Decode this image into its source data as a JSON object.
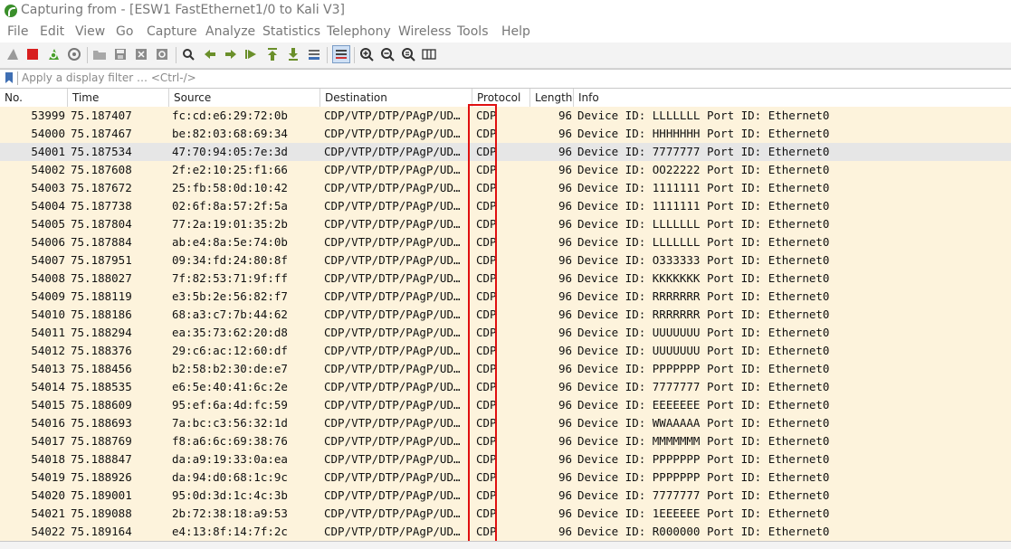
{
  "window": {
    "title": "Capturing from - [ESW1 FastEthernet1/0 to Kali V3]"
  },
  "menu": [
    "File",
    "Edit",
    "View",
    "Go",
    "Capture",
    "Analyze",
    "Statistics",
    "Telephony",
    "Wireless",
    "Tools",
    "Help"
  ],
  "toolbar": {
    "icons": [
      "shark-fin-start-icon",
      "stop-icon",
      "restart-icon",
      "capture-options-icon",
      "open-file-icon",
      "save-file-icon",
      "close-file-icon",
      "reload-file-icon",
      "find-packet-icon",
      "go-back-icon",
      "go-forward-icon",
      "go-to-packet-icon",
      "first-packet-icon",
      "last-packet-icon",
      "autoscroll-icon",
      "colorize-icon",
      "zoom-in-icon",
      "zoom-out-icon",
      "normal-size-icon",
      "resize-columns-icon"
    ]
  },
  "filter": {
    "placeholder": "Apply a display filter … <Ctrl-/>"
  },
  "columns": {
    "no": "No.",
    "time": "Time",
    "source": "Source",
    "destination": "Destination",
    "protocol": "Protocol",
    "length": "Length",
    "info": "Info"
  },
  "colors": {
    "row_bg": "#fdf3dc",
    "selected_bg": "#e6e6e6",
    "highlight": "#e01010"
  },
  "packets": [
    {
      "no": "53999",
      "time": "75.187407",
      "source": "fc:cd:e6:29:72:0b",
      "destination": "CDP/VTP/DTP/PAgP/UD…",
      "protocol": "CDP",
      "length": "96",
      "info": "Device ID: LLLLLLL  Port ID: Ethernet0"
    },
    {
      "no": "54000",
      "time": "75.187467",
      "source": "be:82:03:68:69:34",
      "destination": "CDP/VTP/DTP/PAgP/UD…",
      "protocol": "CDP",
      "length": "96",
      "info": "Device ID: HHHHHHH  Port ID: Ethernet0"
    },
    {
      "no": "54001",
      "time": "75.187534",
      "source": "47:70:94:05:7e:3d",
      "destination": "CDP/VTP/DTP/PAgP/UD…",
      "protocol": "CDP",
      "length": "96",
      "info": "Device ID: 7777777  Port ID: Ethernet0",
      "selected": true
    },
    {
      "no": "54002",
      "time": "75.187608",
      "source": "2f:e2:10:25:f1:66",
      "destination": "CDP/VTP/DTP/PAgP/UD…",
      "protocol": "CDP",
      "length": "96",
      "info": "Device ID: OO22222  Port ID: Ethernet0"
    },
    {
      "no": "54003",
      "time": "75.187672",
      "source": "25:fb:58:0d:10:42",
      "destination": "CDP/VTP/DTP/PAgP/UD…",
      "protocol": "CDP",
      "length": "96",
      "info": "Device ID: 1111111  Port ID: Ethernet0"
    },
    {
      "no": "54004",
      "time": "75.187738",
      "source": "02:6f:8a:57:2f:5a",
      "destination": "CDP/VTP/DTP/PAgP/UD…",
      "protocol": "CDP",
      "length": "96",
      "info": "Device ID: 1111111  Port ID: Ethernet0"
    },
    {
      "no": "54005",
      "time": "75.187804",
      "source": "77:2a:19:01:35:2b",
      "destination": "CDP/VTP/DTP/PAgP/UD…",
      "protocol": "CDP",
      "length": "96",
      "info": "Device ID: LLLLLLL  Port ID: Ethernet0"
    },
    {
      "no": "54006",
      "time": "75.187884",
      "source": "ab:e4:8a:5e:74:0b",
      "destination": "CDP/VTP/DTP/PAgP/UD…",
      "protocol": "CDP",
      "length": "96",
      "info": "Device ID: LLLLLLL  Port ID: Ethernet0"
    },
    {
      "no": "54007",
      "time": "75.187951",
      "source": "09:34:fd:24:80:8f",
      "destination": "CDP/VTP/DTP/PAgP/UD…",
      "protocol": "CDP",
      "length": "96",
      "info": "Device ID: O333333  Port ID: Ethernet0"
    },
    {
      "no": "54008",
      "time": "75.188027",
      "source": "7f:82:53:71:9f:ff",
      "destination": "CDP/VTP/DTP/PAgP/UD…",
      "protocol": "CDP",
      "length": "96",
      "info": "Device ID: KKKKKKK  Port ID: Ethernet0"
    },
    {
      "no": "54009",
      "time": "75.188119",
      "source": "e3:5b:2e:56:82:f7",
      "destination": "CDP/VTP/DTP/PAgP/UD…",
      "protocol": "CDP",
      "length": "96",
      "info": "Device ID: RRRRRRR  Port ID: Ethernet0"
    },
    {
      "no": "54010",
      "time": "75.188186",
      "source": "68:a3:c7:7b:44:62",
      "destination": "CDP/VTP/DTP/PAgP/UD…",
      "protocol": "CDP",
      "length": "96",
      "info": "Device ID: RRRRRRR  Port ID: Ethernet0"
    },
    {
      "no": "54011",
      "time": "75.188294",
      "source": "ea:35:73:62:20:d8",
      "destination": "CDP/VTP/DTP/PAgP/UD…",
      "protocol": "CDP",
      "length": "96",
      "info": "Device ID: UUUUUUU  Port ID: Ethernet0"
    },
    {
      "no": "54012",
      "time": "75.188376",
      "source": "29:c6:ac:12:60:df",
      "destination": "CDP/VTP/DTP/PAgP/UD…",
      "protocol": "CDP",
      "length": "96",
      "info": "Device ID: UUUUUUU  Port ID: Ethernet0"
    },
    {
      "no": "54013",
      "time": "75.188456",
      "source": "b2:58:b2:30:de:e7",
      "destination": "CDP/VTP/DTP/PAgP/UD…",
      "protocol": "CDP",
      "length": "96",
      "info": "Device ID: PPPPPPP  Port ID: Ethernet0"
    },
    {
      "no": "54014",
      "time": "75.188535",
      "source": "e6:5e:40:41:6c:2e",
      "destination": "CDP/VTP/DTP/PAgP/UD…",
      "protocol": "CDP",
      "length": "96",
      "info": "Device ID: 7777777  Port ID: Ethernet0"
    },
    {
      "no": "54015",
      "time": "75.188609",
      "source": "95:ef:6a:4d:fc:59",
      "destination": "CDP/VTP/DTP/PAgP/UD…",
      "protocol": "CDP",
      "length": "96",
      "info": "Device ID: EEEEEEE  Port ID: Ethernet0"
    },
    {
      "no": "54016",
      "time": "75.188693",
      "source": "7a:bc:c3:56:32:1d",
      "destination": "CDP/VTP/DTP/PAgP/UD…",
      "protocol": "CDP",
      "length": "96",
      "info": "Device ID: WWAAAAA  Port ID: Ethernet0"
    },
    {
      "no": "54017",
      "time": "75.188769",
      "source": "f8:a6:6c:69:38:76",
      "destination": "CDP/VTP/DTP/PAgP/UD…",
      "protocol": "CDP",
      "length": "96",
      "info": "Device ID: MMMMMMM  Port ID: Ethernet0"
    },
    {
      "no": "54018",
      "time": "75.188847",
      "source": "da:a9:19:33:0a:ea",
      "destination": "CDP/VTP/DTP/PAgP/UD…",
      "protocol": "CDP",
      "length": "96",
      "info": "Device ID: PPPPPPP  Port ID: Ethernet0"
    },
    {
      "no": "54019",
      "time": "75.188926",
      "source": "da:94:d0:68:1c:9c",
      "destination": "CDP/VTP/DTP/PAgP/UD…",
      "protocol": "CDP",
      "length": "96",
      "info": "Device ID: PPPPPPP  Port ID: Ethernet0"
    },
    {
      "no": "54020",
      "time": "75.189001",
      "source": "95:0d:3d:1c:4c:3b",
      "destination": "CDP/VTP/DTP/PAgP/UD…",
      "protocol": "CDP",
      "length": "96",
      "info": "Device ID: 7777777  Port ID: Ethernet0"
    },
    {
      "no": "54021",
      "time": "75.189088",
      "source": "2b:72:38:18:a9:53",
      "destination": "CDP/VTP/DTP/PAgP/UD…",
      "protocol": "CDP",
      "length": "96",
      "info": "Device ID: 1EEEEEE  Port ID: Ethernet0"
    },
    {
      "no": "54022",
      "time": "75.189164",
      "source": "e4:13:8f:14:7f:2c",
      "destination": "CDP/VTP/DTP/PAgP/UD…",
      "protocol": "CDP",
      "length": "96",
      "info": "Device ID: R000000  Port ID: Ethernet0"
    }
  ]
}
